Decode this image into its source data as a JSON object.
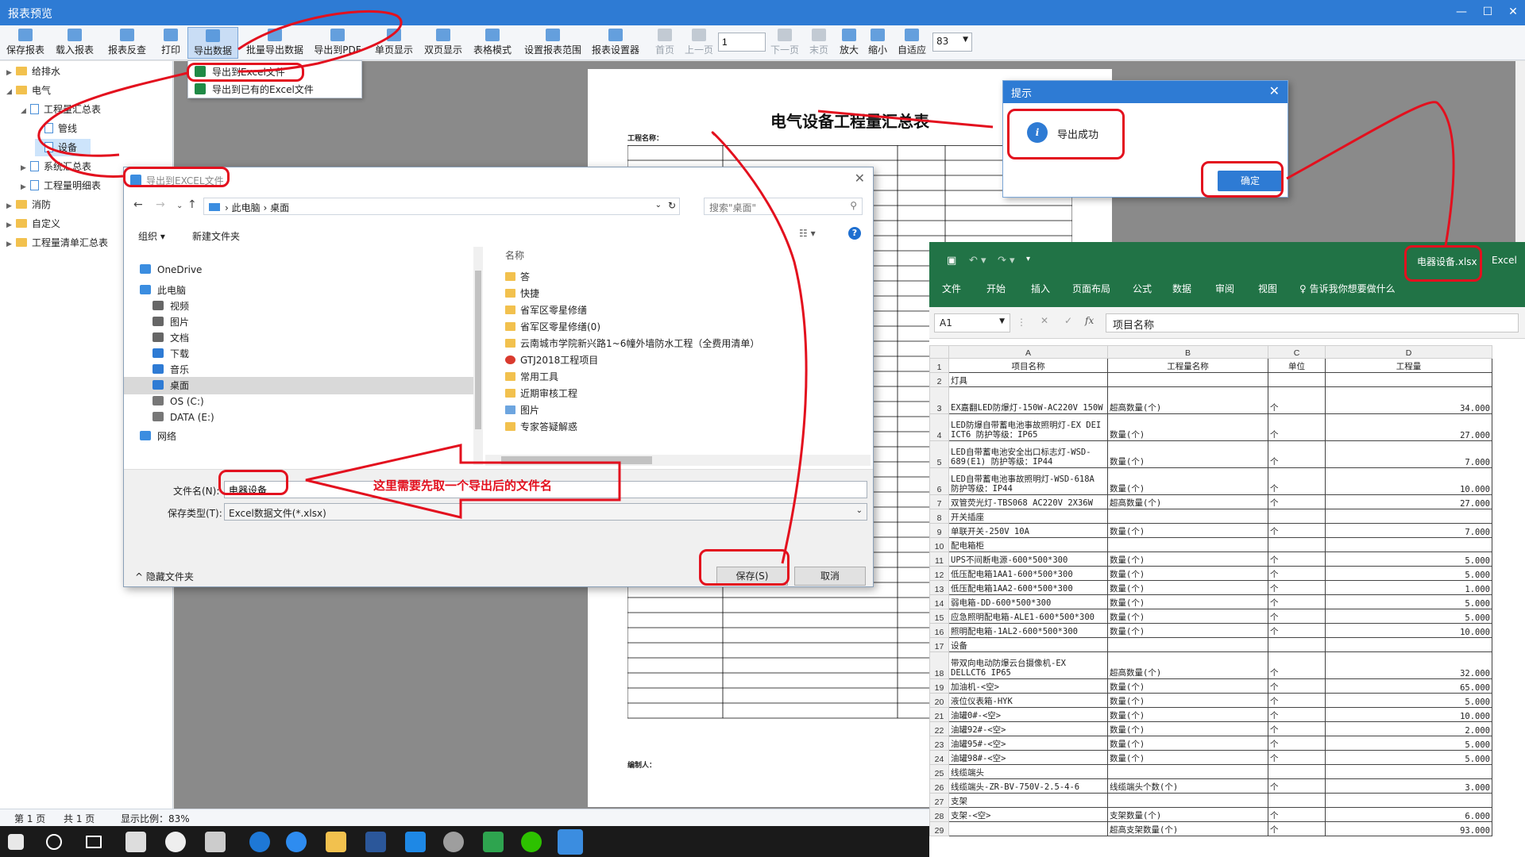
{
  "window": {
    "title": "报表预览",
    "min_icon": "minimize-icon",
    "max_icon": "maximize-icon",
    "close_icon": "close-icon"
  },
  "toolbar": {
    "items": [
      "保存报表",
      "载入报表",
      "报表反查",
      "打印",
      "导出数据",
      "批量导出数据",
      "导出到PDF",
      "单页显示",
      "双页显示",
      "表格模式",
      "设置报表范围",
      "报表设置器",
      "首页",
      "上一页",
      "下一页",
      "末页",
      "放大",
      "缩小",
      "自适应"
    ],
    "page_value": "1",
    "zoom_value": "83"
  },
  "export_menu": {
    "items": [
      "导出到Excel文件",
      "导出到已有的Excel文件"
    ]
  },
  "tree": [
    {
      "label": "给排水",
      "level": 0,
      "arrow": "▶"
    },
    {
      "label": "电气",
      "level": 0,
      "arrow": "◢"
    },
    {
      "label": "工程量汇总表",
      "level": 1,
      "arrow": "◢"
    },
    {
      "label": "管线",
      "level": 2,
      "arrow": ""
    },
    {
      "label": "设备",
      "level": 2,
      "arrow": ""
    },
    {
      "label": "系统汇总表",
      "level": 1,
      "arrow": "▶"
    },
    {
      "label": "工程量明细表",
      "level": 1,
      "arrow": "▶"
    },
    {
      "label": "消防",
      "level": 0,
      "arrow": "▶"
    },
    {
      "label": "自定义",
      "level": 0,
      "arrow": "▶"
    },
    {
      "label": "工程量清单汇总表",
      "level": 0,
      "arrow": "▶"
    }
  ],
  "report": {
    "title": "电气设备工程量汇总表",
    "project": "工程名称：",
    "editor": "编制人："
  },
  "status": {
    "page": "第 1 页",
    "total": "共 1 页",
    "zoom": "显示比例：83%"
  },
  "save_dialog": {
    "title": "导出到EXCEL文件",
    "breadcrumb": [
      "此电脑",
      "桌面"
    ],
    "search_placeholder": "搜索\"桌面\"",
    "organize": "组织 ▾",
    "new_folder": "新建文件夹",
    "nav": [
      {
        "label": "OneDrive",
        "icon": "cloud-icon",
        "color": "#3b8de0"
      },
      {
        "label": "此电脑",
        "icon": "computer-icon",
        "color": "#3b8de0"
      },
      {
        "label": "视频",
        "icon": "video-icon",
        "color": "#666"
      },
      {
        "label": "图片",
        "icon": "pictures-icon",
        "color": "#666"
      },
      {
        "label": "文档",
        "icon": "documents-icon",
        "color": "#666"
      },
      {
        "label": "下载",
        "icon": "download-icon",
        "color": "#2e7bd4"
      },
      {
        "label": "音乐",
        "icon": "music-icon",
        "color": "#2e7bd4"
      },
      {
        "label": "桌面",
        "icon": "desktop-icon",
        "color": "#2e7bd4"
      },
      {
        "label": "OS (C:)",
        "icon": "drive-icon",
        "color": "#777"
      },
      {
        "label": "DATA (E:)",
        "icon": "drive-icon",
        "color": "#777"
      },
      {
        "label": "网络",
        "icon": "network-icon",
        "color": "#3b8de0"
      }
    ],
    "name_header": "名称",
    "files": [
      {
        "label": "答",
        "type": "folder"
      },
      {
        "label": "快捷",
        "type": "folder"
      },
      {
        "label": "省军区零星修缮",
        "type": "folder"
      },
      {
        "label": "省军区零星修缮(0)",
        "type": "folder"
      },
      {
        "label": "云南城市学院新兴路1~6幢外墙防水工程（全费用清单）",
        "type": "folder"
      },
      {
        "label": "GTJ2018工程项目",
        "type": "app"
      },
      {
        "label": "常用工具",
        "type": "folder"
      },
      {
        "label": "近期审核工程",
        "type": "folder"
      },
      {
        "label": "图片",
        "type": "pictures"
      },
      {
        "label": "专家答疑解惑",
        "type": "folder"
      }
    ],
    "filename_label": "文件名(N):",
    "filename_value": "电器设备",
    "filetype_label": "保存类型(T):",
    "filetype_value": "Excel数据文件(*.xlsx)",
    "hide_folders": "隐藏文件夹",
    "save_button": "保存(S)",
    "cancel_button": "取消"
  },
  "annotation": {
    "callout": "这里需要先取一个导出后的文件名",
    "color": "#e3101e"
  },
  "hint_dialog": {
    "title": "提示",
    "message": "导出成功",
    "ok": "确定"
  },
  "excel": {
    "filename": "电器设备.xlsx",
    "app": "Excel",
    "tabs": [
      "文件",
      "开始",
      "插入",
      "页面布局",
      "公式",
      "数据",
      "审阅",
      "视图"
    ],
    "tellme": "告诉我你想要做什么",
    "cell_ref": "A1",
    "formula": "项目名称",
    "columns": [
      "A",
      "B",
      "C",
      "D"
    ],
    "rows": [
      {
        "n": "1",
        "a": "项目名称",
        "b": "工程量名称",
        "c": "单位",
        "d": "工程量",
        "hdr": true
      },
      {
        "n": "2",
        "a": "灯具",
        "b": "",
        "c": "",
        "d": ""
      },
      {
        "n": "3",
        "a": "EX嘉翻LED防爆灯-150W-AC220V 150W",
        "b": "超高数量(个)",
        "c": "个",
        "d": "34.000",
        "tall": true
      },
      {
        "n": "4",
        "a": "LED防爆自带蓄电池事故照明灯-EX DEI ICT6 防护等级：IP65",
        "b": "数量(个)",
        "c": "个",
        "d": "27.000",
        "tall": true
      },
      {
        "n": "5",
        "a": "LED自带蓄电池安全出口标志灯-WSD-689(E1) 防护等级：IP44",
        "b": "数量(个)",
        "c": "个",
        "d": "7.000",
        "tall": true
      },
      {
        "n": "6",
        "a": "LED自带蓄电池事故照明灯-WSD-618A 防护等级：IP44",
        "b": "数量(个)",
        "c": "个",
        "d": "10.000",
        "tall": true
      },
      {
        "n": "7",
        "a": "双管荧光灯-TBS068 AC220V  2X36W",
        "b": "超高数量(个)",
        "c": "个",
        "d": "27.000"
      },
      {
        "n": "8",
        "a": "开关插座",
        "b": "",
        "c": "",
        "d": ""
      },
      {
        "n": "9",
        "a": "单联开关-250V  10A",
        "b": "数量(个)",
        "c": "个",
        "d": "7.000"
      },
      {
        "n": "10",
        "a": "配电箱柜",
        "b": "",
        "c": "",
        "d": ""
      },
      {
        "n": "11",
        "a": "UPS不间断电源-600*500*300",
        "b": "数量(个)",
        "c": "个",
        "d": "5.000"
      },
      {
        "n": "12",
        "a": "低压配电箱1AA1-600*500*300",
        "b": "数量(个)",
        "c": "个",
        "d": "5.000"
      },
      {
        "n": "13",
        "a": "低压配电箱1AA2-600*500*300",
        "b": "数量(个)",
        "c": "个",
        "d": "1.000"
      },
      {
        "n": "14",
        "a": "弱电箱-DD-600*500*300",
        "b": "数量(个)",
        "c": "个",
        "d": "5.000"
      },
      {
        "n": "15",
        "a": "应急照明配电箱-ALE1-600*500*300",
        "b": "数量(个)",
        "c": "个",
        "d": "5.000"
      },
      {
        "n": "16",
        "a": "照明配电箱-1AL2-600*500*300",
        "b": "数量(个)",
        "c": "个",
        "d": "10.000"
      },
      {
        "n": "17",
        "a": "设备",
        "b": "",
        "c": "",
        "d": ""
      },
      {
        "n": "18",
        "a": "带双向电动防爆云台摄像机-EX DELLCT6  IP65",
        "b": "超高数量(个)",
        "c": "个",
        "d": "32.000",
        "tall": true
      },
      {
        "n": "19",
        "a": "加油机-<空>",
        "b": "数量(个)",
        "c": "个",
        "d": "65.000"
      },
      {
        "n": "20",
        "a": "液位仪表箱-HYK",
        "b": "数量(个)",
        "c": "个",
        "d": "5.000"
      },
      {
        "n": "21",
        "a": "油罐0#-<空>",
        "b": "数量(个)",
        "c": "个",
        "d": "10.000"
      },
      {
        "n": "22",
        "a": "油罐92#-<空>",
        "b": "数量(个)",
        "c": "个",
        "d": "2.000"
      },
      {
        "n": "23",
        "a": "油罐95#-<空>",
        "b": "数量(个)",
        "c": "个",
        "d": "5.000"
      },
      {
        "n": "24",
        "a": "油罐98#-<空>",
        "b": "数量(个)",
        "c": "个",
        "d": "5.000"
      },
      {
        "n": "25",
        "a": "线缆端头",
        "b": "",
        "c": "",
        "d": ""
      },
      {
        "n": "26",
        "a": "线缆端头-ZR-BV-750V-2.5-4-6",
        "b": "线缆端头个数(个)",
        "c": "个",
        "d": "3.000"
      },
      {
        "n": "27",
        "a": "支架",
        "b": "",
        "c": "",
        "d": ""
      },
      {
        "n": "28",
        "a": "支架-<空>",
        "b": "支架数量(个)",
        "c": "个",
        "d": "6.000"
      },
      {
        "n": "29",
        "a": "",
        "b": "超高支架数量(个)",
        "c": "个",
        "d": "93.000"
      }
    ]
  }
}
